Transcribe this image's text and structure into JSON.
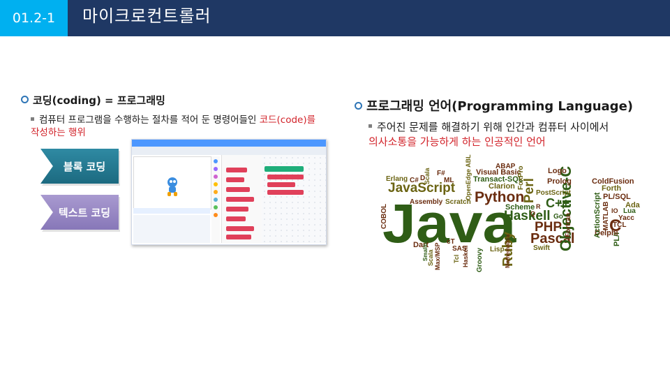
{
  "header": {
    "section_number": "01.2-1",
    "title": "마이크로컨트롤러"
  },
  "left": {
    "heading": "코딩(coding) = 프로그래밍",
    "bullet_line1": "컴퓨터 프로그램을 수행하는 절차를 적어 둔 명령어들인 ",
    "bullet_highlight": "코드(code)를",
    "bullet_line2": "작성하는 행위",
    "block_button": "블록 코딩",
    "text_button": "텍스트 코딩"
  },
  "right": {
    "heading": "프로그래밍 언어(Programming Language)",
    "bullet_line1": "주어진 문제를 해결하기 위해 인간과 컴퓨터 사이에서",
    "bullet_line2": "의사소통을 가능하게 하는 인공적인 언어"
  },
  "word_cloud": [
    "Java",
    "JavaScript",
    "Python",
    "Haskell",
    "PHP",
    "Pascal",
    "Ruby",
    "Perl",
    "Objective-C",
    "C++",
    "ABAP",
    "Visual Basic",
    "Transact-SQL",
    "Clarion",
    "FoxPro",
    "Logo",
    "Prolog",
    "ColdFusion",
    "Forth",
    "PL/SQL",
    "Ada",
    "Lua",
    "Yacc",
    "TCL",
    "PL/I",
    "Delphi",
    "C",
    "MATLAB",
    "ActionScript",
    "Fortran",
    "Go",
    "R",
    "Q",
    "Swift",
    "PostScript",
    "Scheme",
    "Scratch",
    "Assembly",
    "Erlang",
    "C#",
    "D",
    "F#",
    "ML",
    "Scala",
    "OpenEdge ABL",
    "COBOL",
    "Dart",
    "Max/MSP",
    "cT",
    "SAS",
    "Tcl",
    "Haskell",
    "Groovy",
    "Lisp",
    "Mathematica",
    "Scala",
    "IO",
    "Smalltalk"
  ],
  "colors": {
    "header_bg": "#1f3864",
    "section_bg": "#00b0f0",
    "highlight_red": "#d2232a",
    "cloud_green": "#2f5d16",
    "cloud_olive": "#6b6413",
    "cloud_brown": "#6a2c0f"
  }
}
